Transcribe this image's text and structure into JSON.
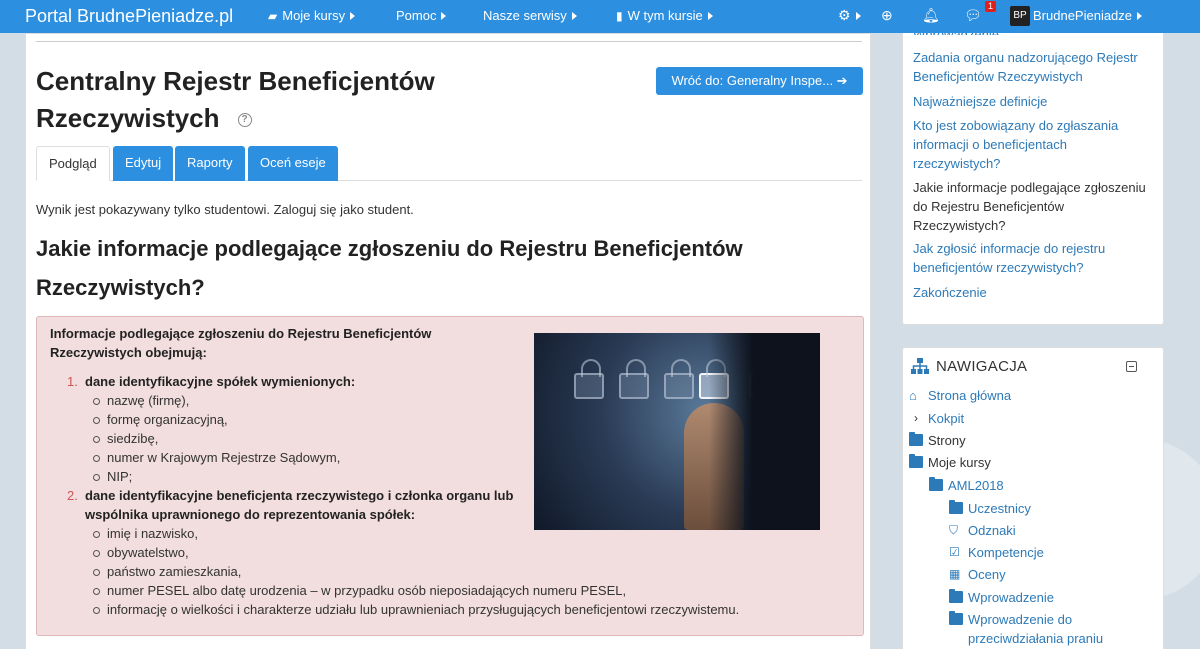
{
  "navbar": {
    "brand": "Portal BrudnePieniadze.pl",
    "items": [
      {
        "label": "Moje kursy",
        "icon": "briefcase-icon"
      },
      {
        "label": "Pomoc"
      },
      {
        "label": "Nasze serwisy"
      },
      {
        "label": "W tym kursie",
        "icon": "book-icon"
      }
    ],
    "notification_count": "1",
    "user_name": "BrudnePieniadze"
  },
  "page": {
    "title": "Centralny Rejestr Beneficjentów Rzeczywistych",
    "back_button": "Wróć do: Generalny Inspe... ➔",
    "tabs": [
      {
        "label": "Podgląd",
        "active": true
      },
      {
        "label": "Edytuj"
      },
      {
        "label": "Raporty"
      },
      {
        "label": "Oceń eseje"
      }
    ],
    "notice": "Wynik jest pokazywany tylko studentowi. Zaloguj się jako student.",
    "heading": "Jakie informacje podlegające zgłoszeniu do Rejestru Beneficjentów Rzeczywistych?",
    "intro": "Informacje podlegające zgłoszeniu do Rejestru Beneficjentów Rzeczywistych obejmują:",
    "list": [
      {
        "num": "1.",
        "title": "dane identyfikacyjne spółek wymienionych:",
        "items": [
          "nazwę (firmę),",
          "formę organizacyjną,",
          "siedzibę,",
          "numer w Krajowym Rejestrze Sądowym,",
          "NIP;"
        ]
      },
      {
        "num": "2.",
        "title": "dane identyfikacyjne beneficjenta rzeczywistego i członka organu lub wspólnika uprawnionego do reprezentowania spółek:",
        "items": [
          "imię i nazwisko,",
          "obywatelstwo,",
          "państwo zamieszkania,",
          "numer PESEL albo datę urodzenia – w przypadku osób nieposiadających numeru PESEL,",
          "informację o wielkości i charakterze udziału lub uprawnieniach przysługujących beneficjentowi rzeczywistemu."
        ]
      }
    ]
  },
  "toc": {
    "items": [
      {
        "label": "Wprowadzenie"
      },
      {
        "label": "Zadania organu nadzorującego Rejestr Beneficjentów Rzeczywistych"
      },
      {
        "label": "Najważniejsze definicje"
      },
      {
        "label": "Kto jest zobowiązany do zgłaszania informacji o beneficjentach rzeczywistych?"
      },
      {
        "label": "Jakie informacje podlegające zgłoszeniu do Rejestru Beneficjentów Rzeczywistych?",
        "current": true
      },
      {
        "label": "Jak zgłosić informacje do rejestru beneficjentów rzeczywistych?"
      },
      {
        "label": "Zakończenie"
      }
    ]
  },
  "navigation": {
    "title": "NAWIGACJA",
    "items": [
      {
        "label": "Strona główna",
        "icon": "home-icon"
      },
      {
        "label": "Kokpit",
        "icon": "chevron-right-icon"
      },
      {
        "label": "Strony",
        "icon": "folder-icon"
      },
      {
        "label": "Moje kursy",
        "icon": "folder-open-icon"
      },
      {
        "label": "AML2018",
        "icon": "folder-open-icon"
      },
      {
        "label": "Uczestnicy",
        "icon": "folder-icon"
      },
      {
        "label": "Odznaki",
        "icon": "shield-icon"
      },
      {
        "label": "Kompetencje",
        "icon": "checkbox-icon"
      },
      {
        "label": "Oceny",
        "icon": "table-icon"
      },
      {
        "label": "Wprowadzenie",
        "icon": "folder-icon"
      },
      {
        "label": "Wprowadzenie do przeciwdziałania praniu pieniędzy",
        "icon": "folder-icon"
      }
    ]
  }
}
